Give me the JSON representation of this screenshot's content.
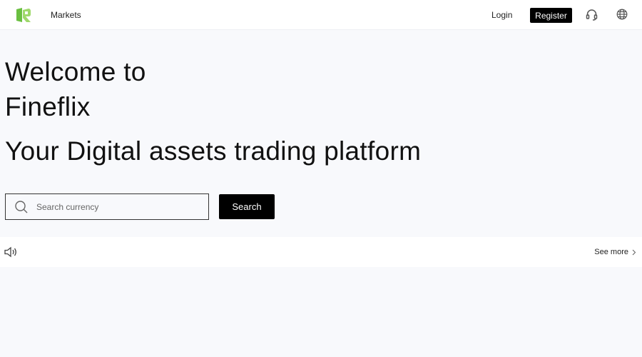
{
  "header": {
    "logo": "fineflix-logo",
    "nav": {
      "markets": "Markets"
    },
    "login_label": "Login",
    "register_label": "Register",
    "icons": [
      "headset-icon",
      "globe-icon"
    ]
  },
  "hero": {
    "title_line1": "Welcome to",
    "title_line2": "Fineflix",
    "subtitle": "Your Digital assets trading platform"
  },
  "search": {
    "placeholder": "Search currency",
    "value": "",
    "button_label": "Search"
  },
  "notice": {
    "icon": "speaker-icon",
    "see_more_label": "See more"
  },
  "colors": {
    "brand_green": "#8bc34a",
    "button_black": "#000000",
    "page_bg": "#f8f9fc"
  }
}
